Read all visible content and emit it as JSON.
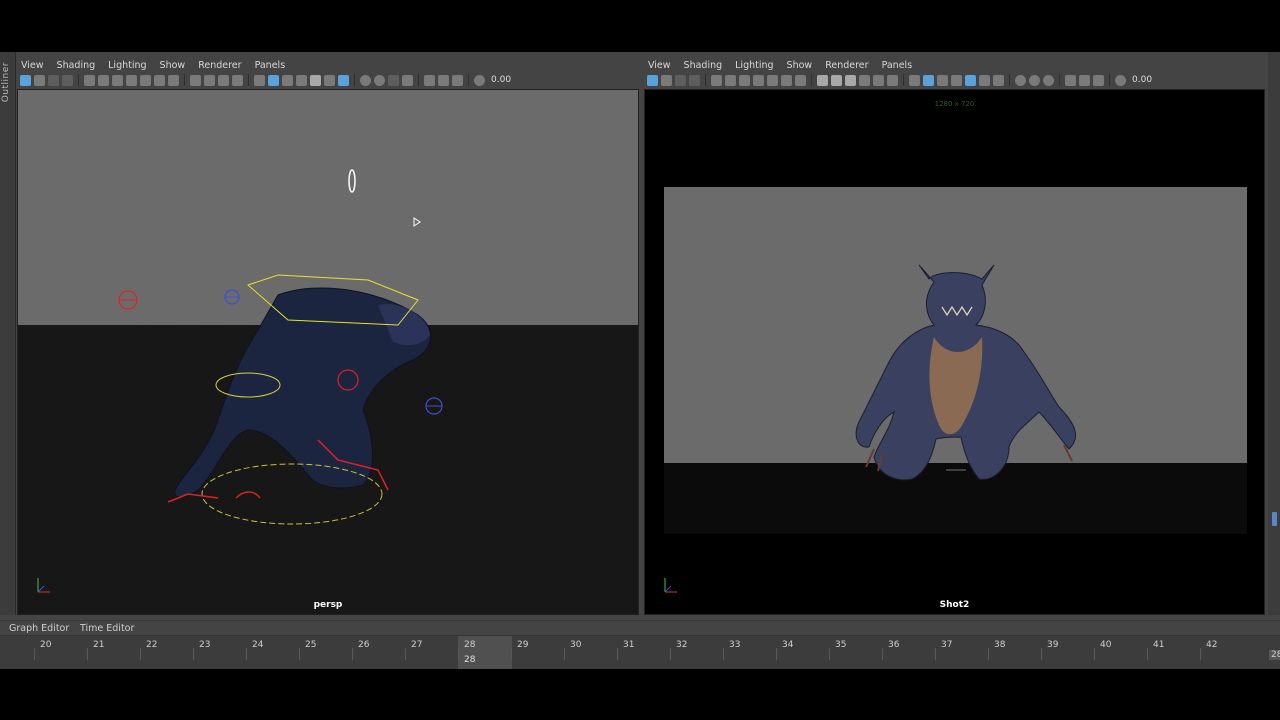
{
  "outliner": {
    "label": "Outliner"
  },
  "panels": {
    "left": {
      "menu": [
        "View",
        "Shading",
        "Lighting",
        "Show",
        "Renderer",
        "Panels"
      ],
      "field_value": "0.00",
      "camera_name": "persp"
    },
    "right": {
      "menu": [
        "View",
        "Shading",
        "Lighting",
        "Show",
        "Renderer",
        "Panels"
      ],
      "field_value": "0.00",
      "camera_name": "Shot2",
      "resolution_label": "1280 x 720"
    }
  },
  "bottom_tabs": [
    "Graph Editor",
    "Time Editor"
  ],
  "timeline": {
    "frames": [
      "20",
      "21",
      "22",
      "23",
      "24",
      "25",
      "26",
      "27",
      "28",
      "29",
      "30",
      "31",
      "32",
      "33",
      "34",
      "35",
      "36",
      "37",
      "38",
      "39",
      "40",
      "41",
      "42"
    ],
    "current_frame": "28",
    "end_frame": "28"
  },
  "colors": {
    "accent_blue": "#5aa2dc",
    "sky_gray": "#6b6b6b",
    "viewport_dark": "#171717",
    "panel_bg": "#444444"
  }
}
